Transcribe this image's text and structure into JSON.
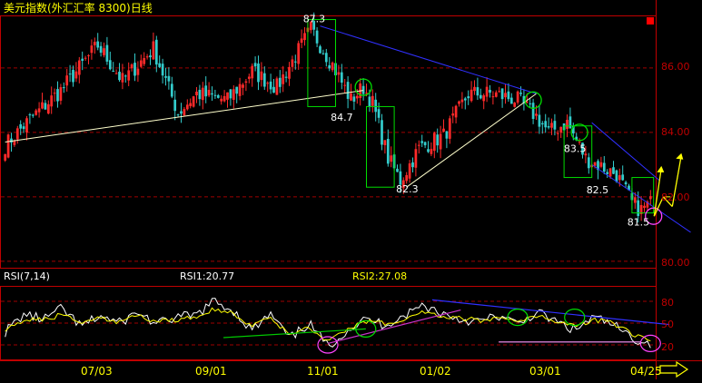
{
  "header": {
    "title": "美元指数(外汇汇率 8300)日线"
  },
  "indicator": {
    "name": "RSI(7,14)",
    "rsi1": "RSI1:20.77",
    "rsi2": "RSI2:27.08"
  },
  "colors": {
    "background": "#000000",
    "frame": "#c00000",
    "grid": "#a00000",
    "price_axis_text": "#c00000",
    "candle_up": "#ff2a2a",
    "candle_down": "#33cccc",
    "title_text": "#ffff00",
    "annotation_text": "#ffffff",
    "support_line": "#ffffcc",
    "resistance_line": "#3030ff",
    "box": "#00dd00",
    "circle_green": "#00dd00",
    "circle_purple": "#ff44ff",
    "arrow": "#ffff00",
    "rsi_fast": "#ffffff",
    "rsi_slow": "#ffff00",
    "rsi_trend_magenta": "#cc33cc",
    "rsi_trend_pink": "#ff99ff",
    "rsi_trend_green": "#00cc00",
    "rsi_trend_blue": "#3030ff",
    "nav_arrow": "#ffff00",
    "corner_marker": "#ff0000"
  },
  "chart_data": [
    {
      "type": "candlestick",
      "title": "美元指数(外汇汇率 8300)日线",
      "x_tick_labels": [
        "07/03",
        "09/01",
        "11/01",
        "01/02",
        "03/01",
        "04/25"
      ],
      "y_tick_labels": [
        "86.00",
        "84.00",
        "82.00",
        "80.00"
      ],
      "ylim": [
        79.8,
        87.6
      ],
      "grid": true,
      "annotations": [
        {
          "label": "87.3",
          "value": 87.3
        },
        {
          "label": "84.7",
          "value": 84.7
        },
        {
          "label": "82.3",
          "value": 82.3
        },
        {
          "label": "83.5",
          "value": 83.5
        },
        {
          "label": "82.5",
          "value": 82.5
        },
        {
          "label": "81.5",
          "value": 81.5
        }
      ],
      "bar_count": 210,
      "key_points": [
        {
          "bar": 0,
          "close": 83.6
        },
        {
          "bar": 8,
          "close": 84.4
        },
        {
          "bar": 18,
          "close": 85.3
        },
        {
          "bar": 30,
          "close": 86.7
        },
        {
          "bar": 38,
          "close": 85.6
        },
        {
          "bar": 48,
          "close": 86.6
        },
        {
          "bar": 56,
          "close": 84.6
        },
        {
          "bar": 62,
          "close": 85.2
        },
        {
          "bar": 72,
          "close": 85.0
        },
        {
          "bar": 80,
          "close": 85.9
        },
        {
          "bar": 88,
          "close": 85.4
        },
        {
          "bar": 96,
          "close": 86.7
        },
        {
          "bar": 99,
          "close": 87.2
        },
        {
          "bar": 106,
          "close": 86.1
        },
        {
          "bar": 112,
          "close": 85.0
        },
        {
          "bar": 116,
          "close": 85.4
        },
        {
          "bar": 119,
          "close": 84.9
        },
        {
          "bar": 124,
          "close": 83.2
        },
        {
          "bar": 128,
          "close": 82.5
        },
        {
          "bar": 134,
          "close": 83.5
        },
        {
          "bar": 142,
          "close": 83.9
        },
        {
          "bar": 150,
          "close": 85.2
        },
        {
          "bar": 158,
          "close": 85.2
        },
        {
          "bar": 166,
          "close": 85.0
        },
        {
          "bar": 172,
          "close": 84.5
        },
        {
          "bar": 176,
          "close": 84.0
        },
        {
          "bar": 182,
          "close": 84.3
        },
        {
          "bar": 188,
          "close": 83.2
        },
        {
          "bar": 194,
          "close": 82.9
        },
        {
          "bar": 198,
          "close": 82.7
        },
        {
          "bar": 203,
          "close": 81.8
        },
        {
          "bar": 206,
          "close": 81.6
        },
        {
          "bar": 209,
          "close": 81.8
        }
      ],
      "trendlines": [
        {
          "name": "support-line",
          "from": {
            "bar": 0,
            "value": 83.7
          },
          "to": {
            "bar": 116,
            "value": 85.3
          }
        },
        {
          "name": "resistance-line-1",
          "from": {
            "bar": 102,
            "value": 87.3
          },
          "to": {
            "bar": 172,
            "value": 85.2
          }
        },
        {
          "name": "support-line-2",
          "from": {
            "bar": 130,
            "value": 82.3
          },
          "to": {
            "bar": 172,
            "value": 85.2
          }
        },
        {
          "name": "resistance-line-2",
          "from": {
            "bar": 190,
            "value": 84.3
          },
          "to": {
            "bar": 212,
            "value": 82.5
          }
        },
        {
          "name": "channel-line-2",
          "from": {
            "bar": 190,
            "value": 83.0
          },
          "to": {
            "bar": 222,
            "value": 80.9
          }
        }
      ],
      "boxes": [
        {
          "from_bar": 98,
          "to_bar": 107,
          "high": 87.5,
          "low": 84.8
        },
        {
          "from_bar": 117,
          "to_bar": 126,
          "high": 84.8,
          "low": 82.3
        },
        {
          "from_bar": 181,
          "to_bar": 190,
          "high": 84.2,
          "low": 82.6
        },
        {
          "from_bar": 203,
          "to_bar": 210,
          "high": 82.6,
          "low": 81.5
        }
      ],
      "markers": [
        {
          "shape": "circle",
          "bar": 116,
          "value": 85.4,
          "color": "green"
        },
        {
          "shape": "circle",
          "bar": 171,
          "value": 85.0,
          "color": "green"
        },
        {
          "shape": "circle",
          "bar": 186,
          "value": 84.0,
          "color": "green"
        },
        {
          "shape": "circle",
          "bar": 210,
          "value": 81.4,
          "color": "purple"
        }
      ]
    },
    {
      "type": "line",
      "title": "RSI(7,14)",
      "y_tick_labels": [
        "80",
        "50",
        "20"
      ],
      "ylim": [
        0,
        100
      ],
      "grid": true,
      "series": [
        {
          "name": "RSI1:20.77",
          "color": "white",
          "key_values": [
            38,
            62,
            55,
            70,
            45,
            60,
            50,
            65,
            48,
            58,
            60,
            80,
            68,
            40,
            62,
            28,
            50,
            18,
            40,
            55,
            48,
            60,
            75,
            64,
            55,
            52,
            60,
            48,
            65,
            52,
            40,
            58,
            48,
            30,
            21
          ]
        },
        {
          "name": "RSI2:27.08",
          "color": "yellow",
          "key_values": [
            42,
            55,
            54,
            62,
            50,
            56,
            52,
            60,
            52,
            55,
            58,
            70,
            64,
            46,
            56,
            35,
            46,
            24,
            42,
            52,
            50,
            56,
            66,
            60,
            56,
            54,
            56,
            50,
            60,
            54,
            46,
            54,
            50,
            36,
            27
          ]
        }
      ],
      "markers": [
        {
          "shape": "circle",
          "index": 19,
          "value": 42,
          "color": "green"
        },
        {
          "shape": "circle",
          "index": 27,
          "value": 58,
          "color": "green"
        },
        {
          "shape": "circle",
          "index": 30,
          "value": 58,
          "color": "green"
        },
        {
          "shape": "circle",
          "index": 17,
          "value": 20,
          "color": "purple"
        },
        {
          "shape": "circle",
          "index": 34,
          "value": 22,
          "color": "purple"
        }
      ]
    }
  ]
}
